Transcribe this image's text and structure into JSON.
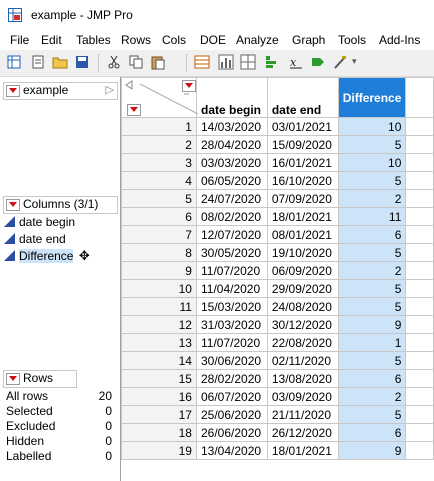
{
  "window": {
    "title": "example - JMP Pro"
  },
  "menu": [
    "File",
    "Edit",
    "Tables",
    "Rows",
    "Cols",
    "DOE",
    "Analyze",
    "Graph",
    "Tools",
    "Add-Ins"
  ],
  "toolbar_icons": [
    "new-table-icon",
    "new-script-icon",
    "open-icon",
    "save-icon",
    "cut-icon",
    "copy-icon",
    "paste-icon",
    "data-table-icon",
    "distribution-icon",
    "fit-y-by-x-icon",
    "fit-model-icon",
    "formula-icon",
    "run-script-icon",
    "annotate-icon"
  ],
  "left": {
    "table_name": "example",
    "columns_header": "Columns (3/1)",
    "columns": [
      "date begin",
      "date end",
      "Difference"
    ],
    "rows_header": "Rows",
    "rows_stats": [
      {
        "label": "All rows",
        "value": "20"
      },
      {
        "label": "Selected",
        "value": "0"
      },
      {
        "label": "Excluded",
        "value": "0"
      },
      {
        "label": "Hidden",
        "value": "0"
      },
      {
        "label": "Labelled",
        "value": "0"
      }
    ]
  },
  "table": {
    "headers": [
      "date begin",
      "date end",
      "Difference"
    ],
    "rows": [
      [
        "1",
        "14/03/2020",
        "03/01/2021",
        "10"
      ],
      [
        "2",
        "28/04/2020",
        "15/09/2020",
        "5"
      ],
      [
        "3",
        "03/03/2020",
        "16/01/2021",
        "10"
      ],
      [
        "4",
        "06/05/2020",
        "16/10/2020",
        "5"
      ],
      [
        "5",
        "24/07/2020",
        "07/09/2020",
        "2"
      ],
      [
        "6",
        "08/02/2020",
        "18/01/2021",
        "11"
      ],
      [
        "7",
        "12/07/2020",
        "08/01/2021",
        "6"
      ],
      [
        "8",
        "30/05/2020",
        "19/10/2020",
        "5"
      ],
      [
        "9",
        "11/07/2020",
        "06/09/2020",
        "2"
      ],
      [
        "10",
        "11/04/2020",
        "29/09/2020",
        "5"
      ],
      [
        "11",
        "15/03/2020",
        "24/08/2020",
        "5"
      ],
      [
        "12",
        "31/03/2020",
        "30/12/2020",
        "9"
      ],
      [
        "13",
        "11/07/2020",
        "22/08/2020",
        "1"
      ],
      [
        "14",
        "30/06/2020",
        "02/11/2020",
        "5"
      ],
      [
        "15",
        "28/02/2020",
        "13/08/2020",
        "6"
      ],
      [
        "16",
        "06/07/2020",
        "03/09/2020",
        "2"
      ],
      [
        "17",
        "25/06/2020",
        "21/11/2020",
        "5"
      ],
      [
        "18",
        "26/06/2020",
        "26/12/2020",
        "6"
      ],
      [
        "19",
        "13/04/2020",
        "18/01/2021",
        "9"
      ]
    ]
  }
}
